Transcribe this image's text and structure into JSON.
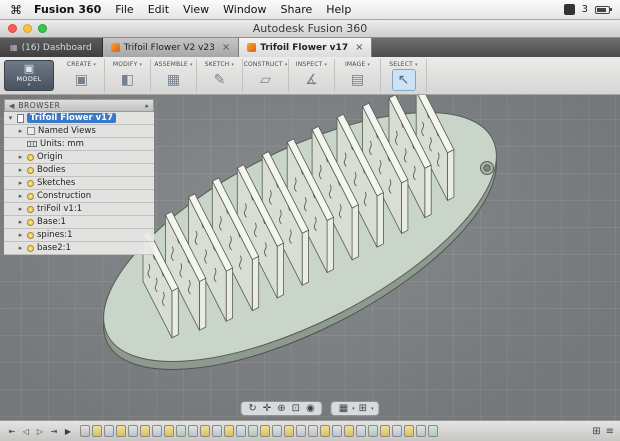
{
  "menubar": {
    "items": [
      "Fusion 360",
      "File",
      "Edit",
      "View",
      "Window",
      "Share",
      "Help"
    ],
    "status_text": "3"
  },
  "titlebar": {
    "title": "Autodesk Fusion 360"
  },
  "tabbar": {
    "dashboard_label": "(16) Dashboard",
    "close_glyph": "×",
    "tabs": [
      {
        "label": "Trifoil Flower V2 v23"
      },
      {
        "label": "Trifoil Flower v17",
        "active": true
      }
    ]
  },
  "toolbar": {
    "workspace_label": "MODEL",
    "groups": [
      {
        "label": "CREATE",
        "icon": "create-icon"
      },
      {
        "label": "MODIFY",
        "icon": "modify-icon"
      },
      {
        "label": "ASSEMBLE",
        "icon": "assemble-icon"
      },
      {
        "label": "SKETCH",
        "icon": "sketch-icon"
      },
      {
        "label": "CONSTRUCT",
        "icon": "construct-icon"
      },
      {
        "label": "INSPECT",
        "icon": "inspect-icon"
      },
      {
        "label": "IMAGE",
        "icon": "image-icon"
      },
      {
        "label": "SELECT",
        "icon": "select-icon",
        "highlighted": true
      }
    ]
  },
  "browser": {
    "title": "BROWSER",
    "items": [
      {
        "label": "Trifoil Flower v17",
        "icon": "document",
        "arrow": true,
        "open": true,
        "selected": true
      },
      {
        "label": "Named Views",
        "icon": "views",
        "arrow": true
      },
      {
        "label": "Units: mm",
        "icon": "units",
        "arrow": false
      },
      {
        "label": "Origin",
        "icon": "bulb",
        "arrow": true
      },
      {
        "label": "Bodies",
        "icon": "bulb",
        "arrow": true
      },
      {
        "label": "Sketches",
        "icon": "bulb",
        "arrow": true
      },
      {
        "label": "Construction",
        "icon": "bulb",
        "arrow": true
      },
      {
        "label": "triFoil v1:1",
        "icon": "bulb",
        "arrow": true
      },
      {
        "label": "Base:1",
        "icon": "bulb",
        "arrow": true
      },
      {
        "label": "spines:1",
        "icon": "bulb",
        "arrow": true
      },
      {
        "label": "base2:1",
        "icon": "bulb",
        "arrow": true
      }
    ]
  },
  "viewport": {
    "model_colors": {
      "top": "#c9d5c9",
      "side": "#8e998f",
      "outline": "#565c52",
      "fin_face": "#d8ded4",
      "fin_top": "#f3f5ef",
      "fin_side": "#e9ece5",
      "hole_rim": "#aab3a8",
      "hole_inner": "#7e877d"
    }
  },
  "nav_toolbar": {
    "view_icons": [
      "orbit",
      "pan",
      "zoom",
      "fit",
      "look-at"
    ],
    "display_icons": [
      "display-settings",
      "grid-settings"
    ]
  },
  "timeline": {
    "playback": [
      "go-to-start",
      "step-back",
      "step-forward",
      "go-to-end",
      "play"
    ],
    "features": [
      "component",
      "sketch",
      "extrude",
      "sketch",
      "extrude",
      "sketch",
      "extrude",
      "sketch",
      "pattern",
      "extrude",
      "sketch",
      "extrude",
      "sketch",
      "extrude",
      "pattern",
      "sketch",
      "extrude",
      "sketch",
      "extrude",
      "component",
      "sketch",
      "extrude",
      "sketch",
      "extrude",
      "pattern",
      "sketch",
      "extrude",
      "sketch",
      "extrude",
      "pattern"
    ]
  }
}
